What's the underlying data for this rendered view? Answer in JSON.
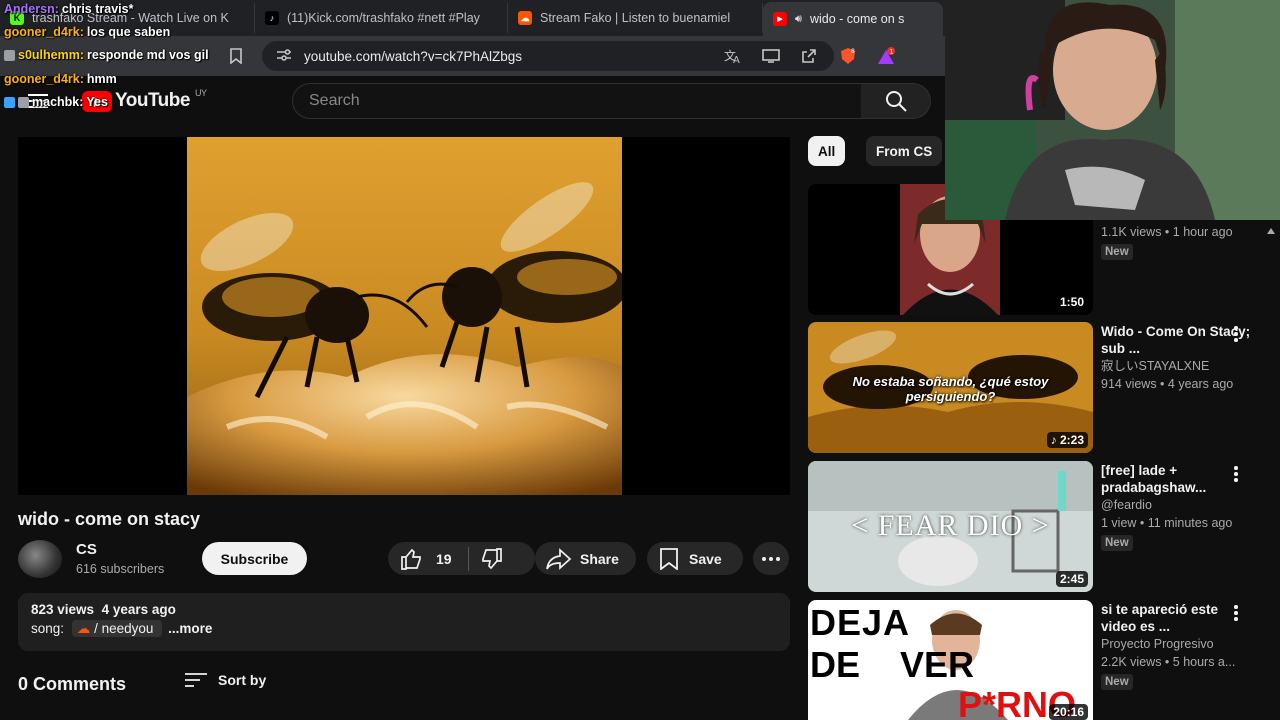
{
  "browser": {
    "tabs": [
      {
        "label": "trashfako Stream - Watch Live on K",
        "fav_color": "#53fc18",
        "fav_glyph": "K"
      },
      {
        "label": "(11)Kick.com/trashfako #nett #Play",
        "fav_color": "#000000",
        "fav_glyph": "♪"
      },
      {
        "label": "Stream Fako | Listen to buenamiel",
        "fav_color": "#ff5500",
        "fav_glyph": "☁"
      },
      {
        "label": "wido - come on s",
        "fav_color": "#ff0000",
        "fav_glyph": "▶"
      }
    ],
    "url": "youtube.com/watch?v=ck7PhAlZbgs",
    "extension_badge": "1"
  },
  "youtube": {
    "region": "UY",
    "logo_text": "YouTube",
    "search_placeholder": "Search"
  },
  "chat": [
    {
      "user": "Andersn:",
      "msg": "chris travis*",
      "color": "#a970ff"
    },
    {
      "user": "gooner_d4rk:",
      "msg": "los que saben",
      "color": "#ffb300"
    },
    {
      "user": "s0ulhemm:",
      "msg": "responde md vos gil",
      "color": "#ffd400"
    },
    {
      "user": "gooner_d4rk:",
      "msg": "hmm",
      "color": "#ffb300"
    },
    {
      "user": "machbk:",
      "msg": "Yes",
      "color": "#ffffff"
    }
  ],
  "video": {
    "title": "wido - come on stacy",
    "channel": "CS",
    "subscribers": "616 subscribers",
    "subscribe_label": "Subscribe",
    "likes": "19",
    "share_label": "Share",
    "save_label": "Save",
    "views": "823 views",
    "age": "4 years ago",
    "song_label": "song:",
    "song_link": "/ needyou",
    "more_label": "...more",
    "comments": "0 Comments",
    "sort_label": "Sort by"
  },
  "chips": [
    "All",
    "From CS"
  ],
  "related": [
    {
      "title": "",
      "channel": "",
      "stats": "1.1K views • 1 hour ago",
      "badge": "New",
      "duration": "1:50"
    },
    {
      "title": "Wido - Come On Stacy; sub ...",
      "channel": "寂しいSTAYALXNE",
      "stats": "914 views • 4 years ago",
      "badge": "",
      "duration": "2:23",
      "caption": "No estaba soñando, ¿qué estoy persiguiendo?"
    },
    {
      "title": "[free] lade + pradabagshaw...",
      "channel": "@feardio",
      "stats": "1 view • 11 minutes ago",
      "badge": "New",
      "duration": "2:45",
      "caption": "< FEAR DIO >"
    },
    {
      "title": "si te apareció este video es ...",
      "channel": "Proyecto Progresivo",
      "stats": "2.2K views • 5 hours a...",
      "badge": "New",
      "duration": "20:16",
      "caption_top": "DEJA",
      "caption_mid": "DE    VER",
      "caption_bottom": "P*RNO"
    }
  ],
  "colors": {
    "background": "#0f0f0f",
    "accent_red": "#ff0000",
    "chip_active": "#f1f1f1",
    "chip_inactive": "#272727"
  }
}
